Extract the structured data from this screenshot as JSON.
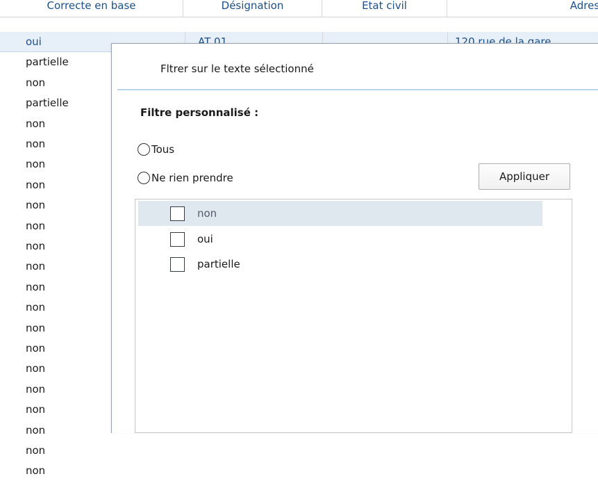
{
  "grid": {
    "columns": [
      "Correcte en base",
      "Désignation",
      "Etat civil",
      "Adress"
    ],
    "rows": [
      {
        "correcte": "oui",
        "designation": "AT 01",
        "etat_civil": "",
        "adresse": "120 rue de la gare",
        "selected": true
      },
      {
        "correcte": "partielle"
      },
      {
        "correcte": "non"
      },
      {
        "correcte": "partielle"
      },
      {
        "correcte": "non"
      },
      {
        "correcte": "non"
      },
      {
        "correcte": "non"
      },
      {
        "correcte": "non"
      },
      {
        "correcte": "non"
      },
      {
        "correcte": "non"
      },
      {
        "correcte": "non"
      },
      {
        "correcte": "non"
      },
      {
        "correcte": "non"
      },
      {
        "correcte": "non"
      },
      {
        "correcte": "non"
      },
      {
        "correcte": "non"
      },
      {
        "correcte": "non"
      },
      {
        "correcte": "non"
      },
      {
        "correcte": "non"
      },
      {
        "correcte": "non"
      },
      {
        "correcte": "non"
      },
      {
        "correcte": "non"
      }
    ]
  },
  "filter_popup": {
    "menu_item": "Fltrer sur le texte sélectionné",
    "custom_filter_title": "Filtre personnalisé :",
    "radio_all": "Tous",
    "radio_none": "Ne rien prendre",
    "apply_button": "Appliquer",
    "values": [
      {
        "label": "non",
        "checked": false,
        "highlighted": true
      },
      {
        "label": "oui",
        "checked": false,
        "highlighted": false
      },
      {
        "label": "partielle",
        "checked": false,
        "highlighted": false
      }
    ]
  },
  "colors": {
    "header_text": "#1d4f88",
    "selected_row": "#e7eff8",
    "separator": "#b9d5ea",
    "highlight_item": "#dfe7ef"
  }
}
